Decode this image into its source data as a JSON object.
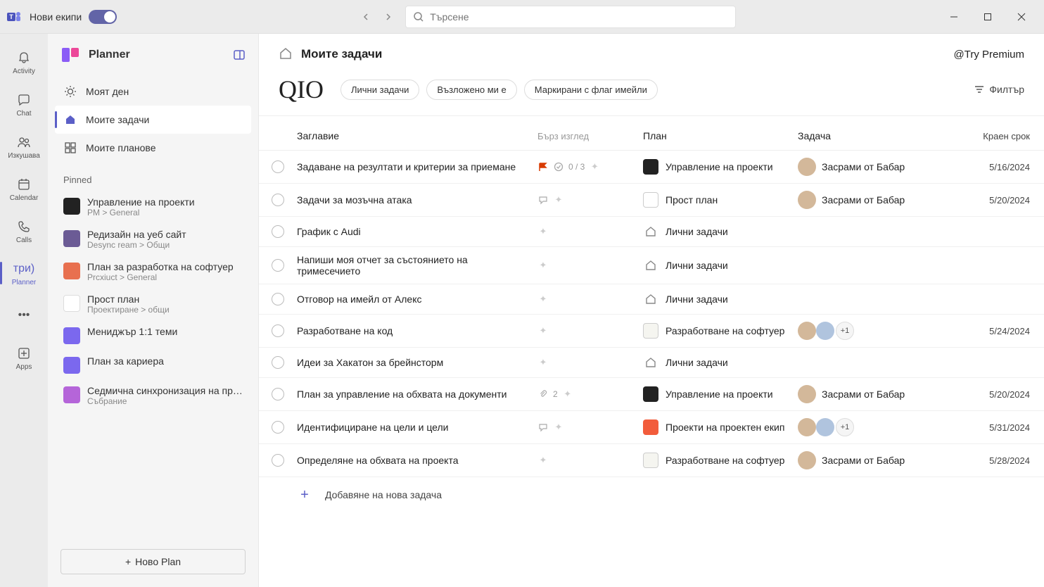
{
  "titlebar": {
    "new_teams_label": "Нови екипи",
    "search_placeholder": "Търсене"
  },
  "apprail": {
    "items": [
      {
        "label": "Activity"
      },
      {
        "label": "Chat"
      },
      {
        "label": "Изкушава"
      },
      {
        "label": "Calendar"
      },
      {
        "label": "Calls"
      },
      {
        "label": "три)"
      },
      {
        "label": "Planner"
      },
      {
        "label": "•••"
      },
      {
        "label": "Apps"
      }
    ]
  },
  "sidebar": {
    "app_title": "Planner",
    "nav": [
      {
        "label": "Моят ден"
      },
      {
        "label": "Моите задачи"
      },
      {
        "label": "Моите планове"
      }
    ],
    "pinned_label": "Pinned",
    "pinned": [
      {
        "title": "Управление на проекти",
        "sub": "PM > General",
        "color": "#222"
      },
      {
        "title": "Редизайн на уеб сайт",
        "sub": "Desync ream > Общи",
        "color": "#6b5b95"
      },
      {
        "title": "План за разработка на софтуер",
        "sub": "Prcxiuct > General",
        "color": "#e8704f"
      },
      {
        "title": "Прост план",
        "sub": "Проектиране > общи",
        "color": "#ffffff"
      },
      {
        "title": "Мениджър 1:1 теми",
        "sub": "",
        "color": "#7b68ee"
      },
      {
        "title": "План за кариера",
        "sub": "",
        "color": "#7b68ee"
      },
      {
        "title": "Седмична синхронизация на проект",
        "sub": "Събрание",
        "color": "#b565d9"
      }
    ],
    "new_plan_label": "Ново Plan"
  },
  "header": {
    "page_title": "Моите задачи",
    "premium_label": "@Try Premium",
    "big_label": "QIO",
    "pills": [
      "Лични задачи",
      "Възложено ми е",
      "Маркирани с флаг имейли"
    ],
    "filter_label": "Филтър"
  },
  "columns": {
    "title": "Заглавие",
    "quick": "Бърз изглед",
    "plan": "План",
    "assign": "Задача",
    "due": "Краен срок"
  },
  "tasks": [
    {
      "title": "Задаване на резултати и критерии за приемане",
      "quick": "0 / 3",
      "flag": true,
      "plan": "Управление на проекти",
      "plan_color": "#222",
      "plan_type": "plan",
      "assignee": "Засрами от Бабар",
      "avatars": 1,
      "extra": 0,
      "due": "5/16/2024"
    },
    {
      "title": "Задачи за мозъчна атака",
      "quick": "",
      "flag": false,
      "comment": true,
      "plan": "Прост план",
      "plan_color": "#fff",
      "plan_type": "plan",
      "assignee": "Засрами от Бабар",
      "avatars": 1,
      "extra": 0,
      "due": "5/20/2024"
    },
    {
      "title": "График с Audi",
      "quick": "",
      "flag": false,
      "plan": "Лични задачи",
      "plan_type": "personal",
      "assignee": "",
      "avatars": 0,
      "extra": 0,
      "due": ""
    },
    {
      "title": "Напиши моя отчет за състоянието на тримесечието",
      "quick": "",
      "flag": false,
      "plan": "Лични задачи",
      "plan_type": "personal",
      "assignee": "",
      "avatars": 0,
      "extra": 0,
      "due": ""
    },
    {
      "title": "Отговор на имейл от Алекс",
      "quick": "",
      "flag": false,
      "plan": "Лични задачи",
      "plan_type": "personal",
      "assignee": "",
      "avatars": 0,
      "extra": 0,
      "due": ""
    },
    {
      "title": "Разработване на код",
      "quick": "",
      "flag": false,
      "plan": "Разработване на софтуер",
      "plan_color": "#f5f5f0",
      "plan_type": "plan",
      "assignee": "",
      "avatars": 2,
      "extra": 1,
      "due": "5/24/2024"
    },
    {
      "title": "Идеи за Хакатон за брейнсторм",
      "quick": "",
      "flag": false,
      "plan": "Лични задачи",
      "plan_type": "personal",
      "assignee": "",
      "avatars": 0,
      "extra": 0,
      "due": ""
    },
    {
      "title": "План за управление на обхвата на документи",
      "quick": "",
      "flag": false,
      "attach": "2",
      "plan": "Управление на проекти",
      "plan_color": "#222",
      "plan_type": "plan",
      "assignee": "Засрами от Бабар",
      "avatars": 1,
      "extra": 0,
      "due": "5/20/2024"
    },
    {
      "title": "Идентифициране на цели и цели",
      "quick": "",
      "flag": false,
      "comment": true,
      "plan": "Проекти на проектен екип",
      "plan_color": "#f25c3b",
      "plan_type": "plan",
      "assignee": "",
      "avatars": 2,
      "extra": 1,
      "due": "5/31/2024"
    },
    {
      "title": "Определяне на обхвата на проекта",
      "quick": "",
      "flag": false,
      "plan": "Разработване на софтуер",
      "plan_color": "#f5f5f0",
      "plan_type": "plan",
      "assignee": "Засрами от Бабар",
      "avatars": 1,
      "extra": 0,
      "due": "5/28/2024"
    }
  ],
  "add_task_label": "Добавяне на нова задача"
}
